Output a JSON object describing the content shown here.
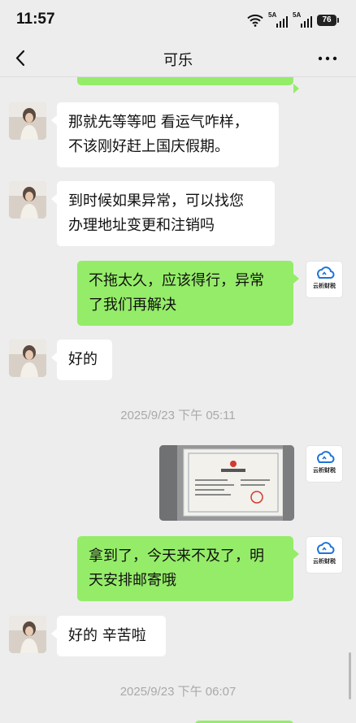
{
  "status_bar": {
    "time": "11:57",
    "signal_1_label": "5A",
    "signal_2_label": "5A",
    "battery": "76"
  },
  "header": {
    "title": "可乐"
  },
  "brand_logo_text": "云析财税",
  "messages": [
    {
      "side": "left",
      "text": "那就先等等吧 看运气咋样，\n不该刚好赶上国庆假期。"
    },
    {
      "side": "left",
      "text": "到时候如果异常，可以找您\n办理地址变更和注销吗"
    },
    {
      "side": "right",
      "text": "不拖太久，应该得行，异常\n了我们再解决"
    },
    {
      "side": "left",
      "text": "好的"
    },
    {
      "type": "timestamp",
      "text": "2025/9/23 下午 05:11"
    },
    {
      "side": "right",
      "type": "image",
      "description": "business license photo"
    },
    {
      "side": "right",
      "text": "拿到了，今天来不及了，明\n天安排邮寄哦"
    },
    {
      "side": "left",
      "text": "好的 辛苦啦"
    },
    {
      "type": "timestamp",
      "text": "2025/9/23 下午 06:07"
    }
  ],
  "colors": {
    "background": "#ededed",
    "own_bubble": "#95ec69",
    "other_bubble": "#ffffff",
    "timestamp_text": "#a9a9a9"
  }
}
